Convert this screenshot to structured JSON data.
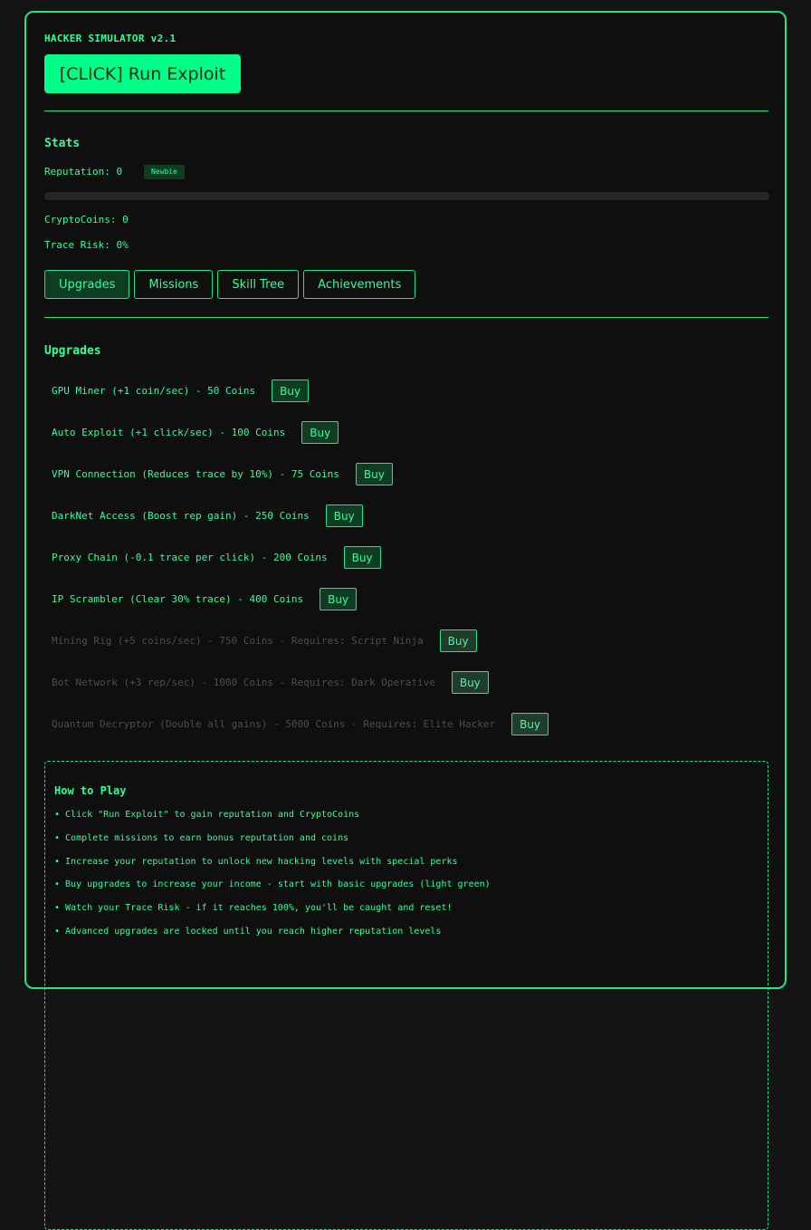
{
  "app": {
    "title": "HACKER SIMULATOR v2.1"
  },
  "run_button": {
    "label": "[CLICK] Run Exploit"
  },
  "stats": {
    "title": "Stats",
    "reputation": "Reputation: 0",
    "rank_badge": "Newbie",
    "reputation_progress": 0,
    "crypto": "CryptoCoins: 0",
    "trace": "Trace Risk: 0%"
  },
  "tabs": [
    {
      "label": "Upgrades",
      "active": true
    },
    {
      "label": "Missions",
      "active": false
    },
    {
      "label": "Skill Tree",
      "active": false
    },
    {
      "label": "Achievements",
      "active": false
    }
  ],
  "upgrades": {
    "title": "Upgrades",
    "buy_label": "Buy",
    "items": [
      {
        "label": "GPU Miner (+1 coin/sec) - 50 Coins",
        "locked": false
      },
      {
        "label": "Auto Exploit (+1 click/sec) - 100 Coins",
        "locked": false
      },
      {
        "label": "VPN Connection (Reduces trace by 10%) - 75 Coins",
        "locked": false
      },
      {
        "label": "DarkNet Access (Boost rep gain) - 250 Coins",
        "locked": false
      },
      {
        "label": "Proxy Chain (-0.1 trace per click) - 200 Coins",
        "locked": false
      },
      {
        "label": "IP Scrambler (Clear 30% trace) - 400 Coins",
        "locked": false
      },
      {
        "label": "Mining Rig (+5 coins/sec) - 750 Coins - Requires: Script Ninja",
        "locked": true
      },
      {
        "label": "Bot Network (+3 rep/sec) - 1000 Coins - Requires: Dark Operative",
        "locked": true
      },
      {
        "label": "Quantum Decryptor (Double all gains) - 5000 Coins - Requires: Elite Hacker",
        "locked": true
      }
    ]
  },
  "how_to_play": {
    "title": "How to Play",
    "items": [
      "• Click \"Run Exploit\" to gain reputation and CryptoCoins",
      "• Complete missions to earn bonus reputation and coins",
      "• Increase your reputation to unlock new hacking levels with special perks",
      "• Buy upgrades to increase your income - start with basic upgrades (light green)",
      "• Watch your Trace Risk - if it reaches 100%, you'll be caught and reset!",
      "• Advanced upgrades are locked until you reach higher reputation levels"
    ]
  },
  "colors": {
    "accent": "#00ff88",
    "text": "#33ff99",
    "background": "#141414",
    "locked_text": "#4d4d4d"
  }
}
